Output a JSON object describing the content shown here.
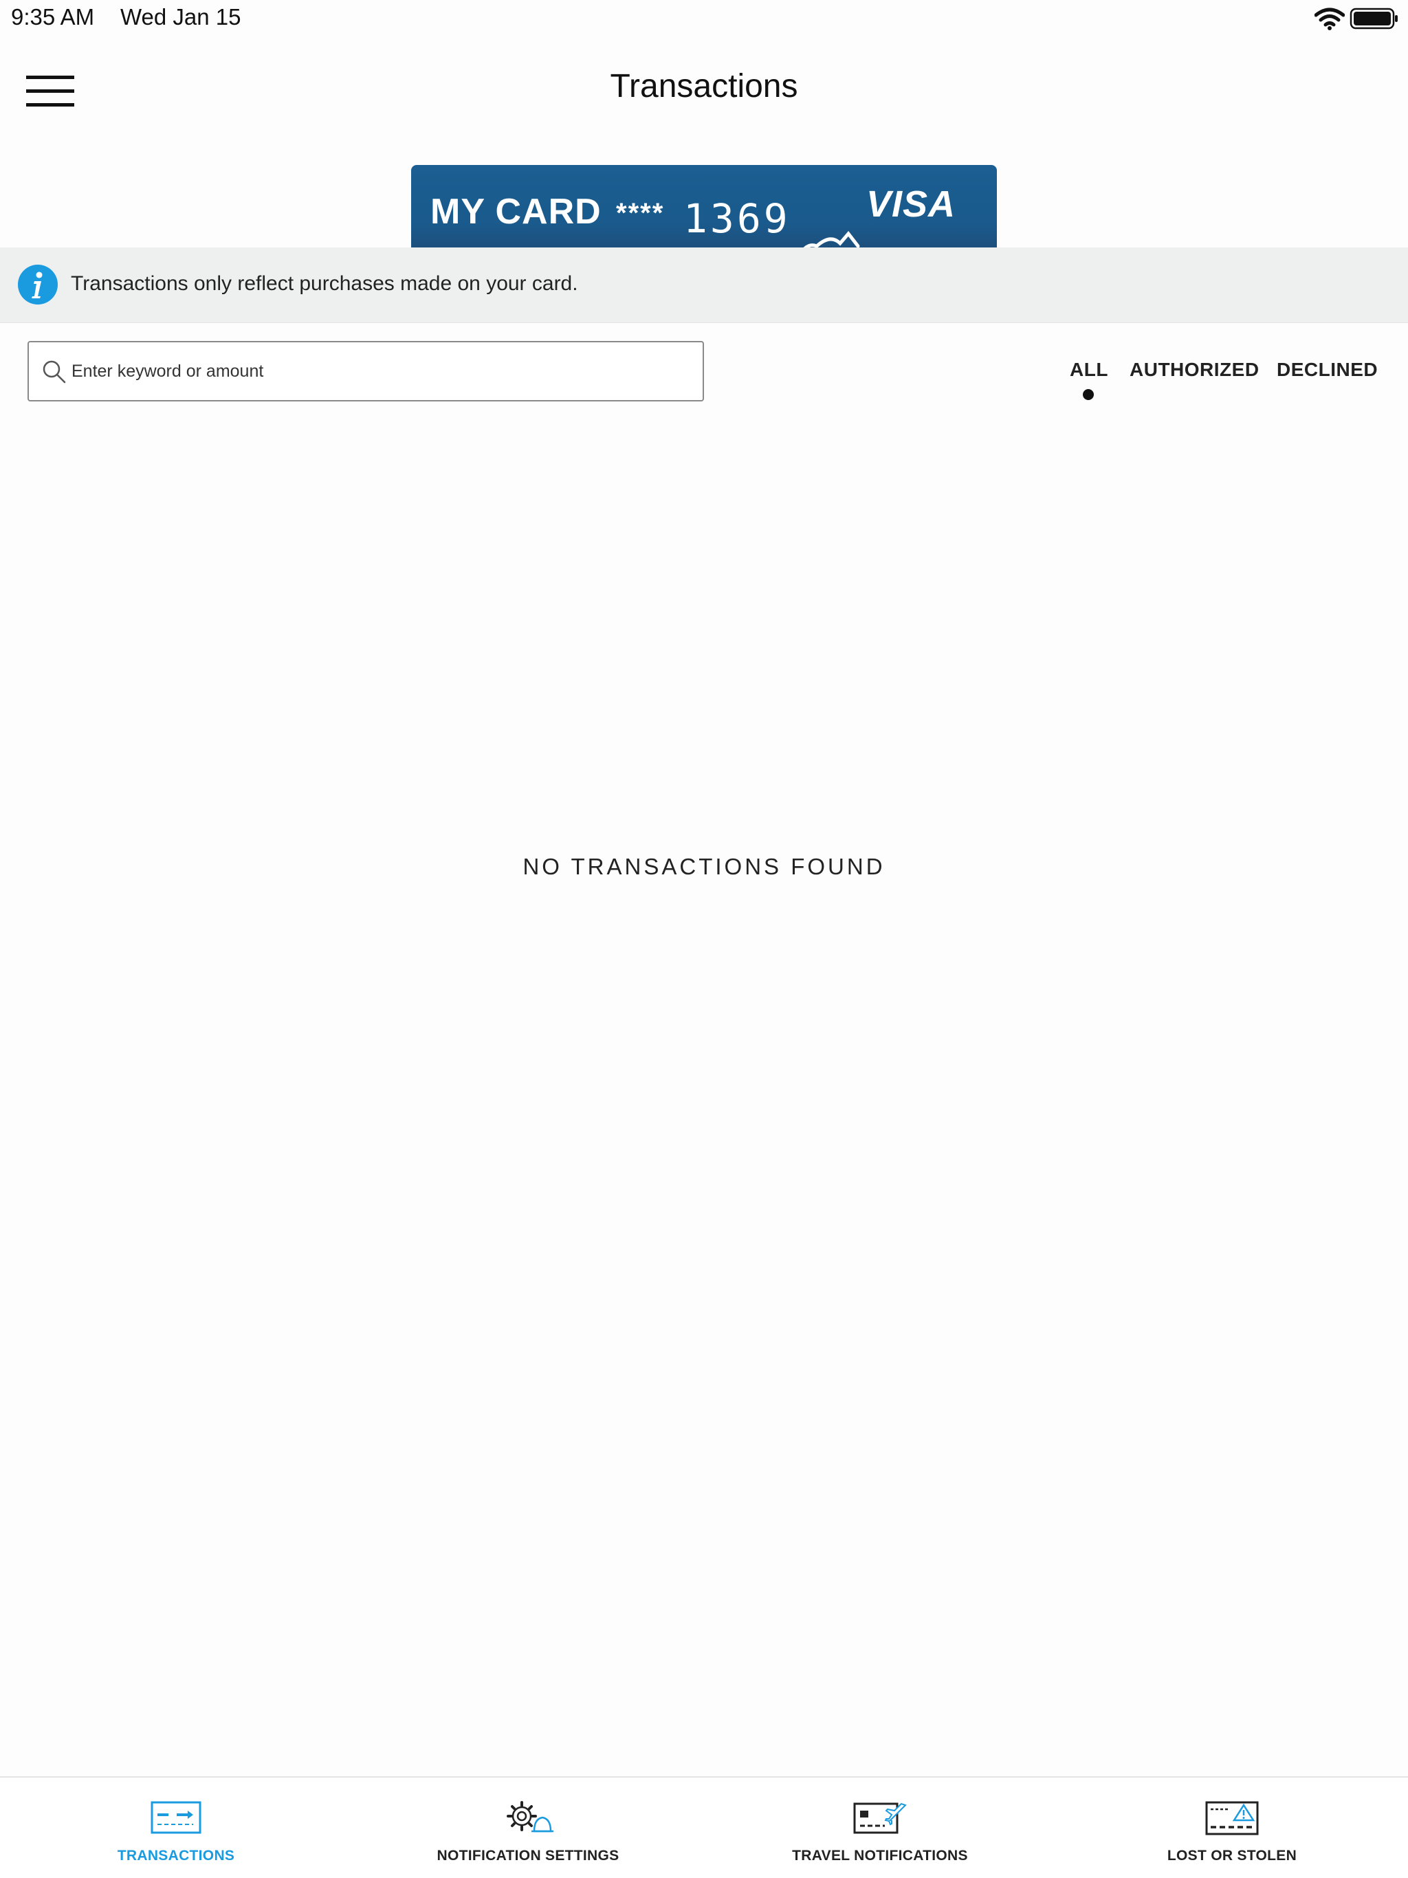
{
  "status_bar": {
    "time": "9:35 AM",
    "date": "Wed Jan 15"
  },
  "header": {
    "title": "Transactions",
    "menu_icon": "hamburger-menu-icon"
  },
  "card": {
    "name": "MY CARD",
    "mask": "****",
    "last_digits": "1369",
    "brand": "VISA",
    "color": "#1a5a8c"
  },
  "info_banner": {
    "icon": "info-icon",
    "text": "Transactions only reflect purchases made on your card.",
    "icon_color": "#1a9be0"
  },
  "search": {
    "placeholder": "Enter keyword or amount",
    "value": ""
  },
  "filters": {
    "tabs": [
      "ALL",
      "AUTHORIZED",
      "DECLINED"
    ],
    "selected": "ALL"
  },
  "empty_state": {
    "message": "NO TRANSACTIONS FOUND"
  },
  "bottom_nav": {
    "active_color": "#1a9be0",
    "items": [
      {
        "label": "TRANSACTIONS",
        "icon": "card-transfer-icon",
        "active": true
      },
      {
        "label": "NOTIFICATION SETTINGS",
        "icon": "gear-bell-icon",
        "active": false
      },
      {
        "label": "TRAVEL NOTIFICATIONS",
        "icon": "card-plane-icon",
        "active": false
      },
      {
        "label": "LOST OR STOLEN",
        "icon": "card-warning-icon",
        "active": false
      }
    ]
  }
}
